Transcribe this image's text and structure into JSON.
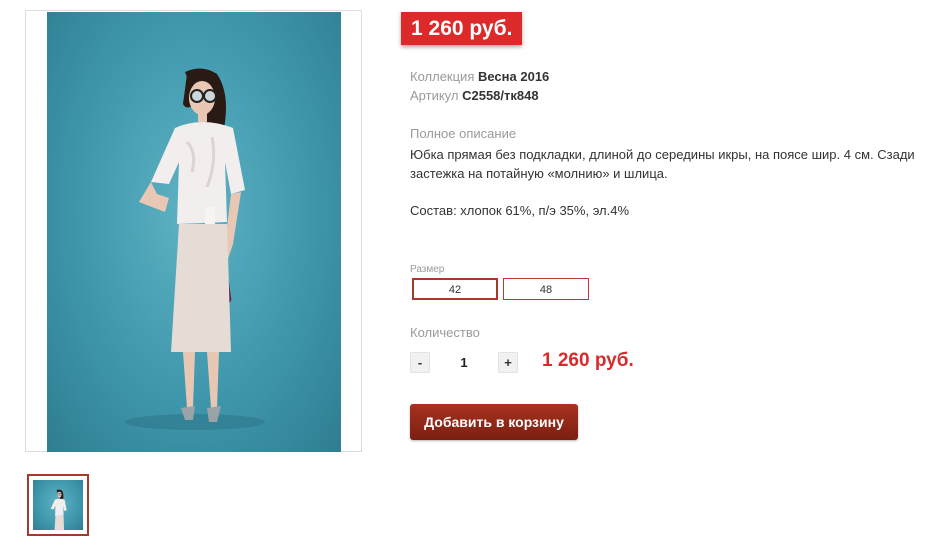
{
  "product": {
    "price_badge": "1 260 руб.",
    "collection_label": "Коллекция",
    "collection_value": "Весна 2016",
    "article_label": "Артикул",
    "article_value": "С2558/тк848",
    "description_label": "Полное описание",
    "description_text": "Юбка прямая без подкладки, длиной до середины икры, на поясе шир. 4 см. Сзади застежка на потайную «молнию» и шлица.",
    "composition": "Состав: хлопок 61%, п/э 35%, эл.4%"
  },
  "size": {
    "label": "Размер",
    "options": [
      "42",
      "48"
    ],
    "selected": "42"
  },
  "quantity": {
    "label": "Количество",
    "minus": "-",
    "value": "1",
    "plus": "+",
    "total": "1 260 руб."
  },
  "cart": {
    "button_label": "Добавить в корзину"
  },
  "colors": {
    "accent_red": "#dc2a2a",
    "button_dark_red": "#8e2716",
    "photo_background": "#3f97ac"
  }
}
